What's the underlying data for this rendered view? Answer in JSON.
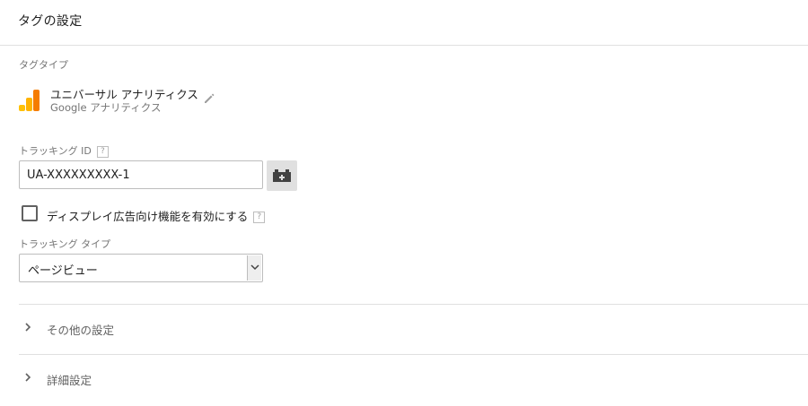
{
  "header": {
    "title": "タグの設定"
  },
  "tag_type": {
    "section_label": "タグタイプ",
    "name": "ユニバーサル アナリティクス",
    "subtitle": "Google アナリティクス",
    "icon": "google-analytics-icon",
    "icon_colors": [
      "#ffc107",
      "#ffb300",
      "#f57c00"
    ]
  },
  "tracking_id": {
    "label": "トラッキング ID",
    "help": "?",
    "value": "UA-XXXXXXXXX-1"
  },
  "display_ads": {
    "label": "ディスプレイ広告向け機能を有効にする",
    "help": "?",
    "checked": false
  },
  "tracking_type": {
    "label": "トラッキング タイプ",
    "selected": "ページビュー"
  },
  "sections": [
    {
      "label": "その他の設定"
    },
    {
      "label": "詳細設定"
    }
  ]
}
